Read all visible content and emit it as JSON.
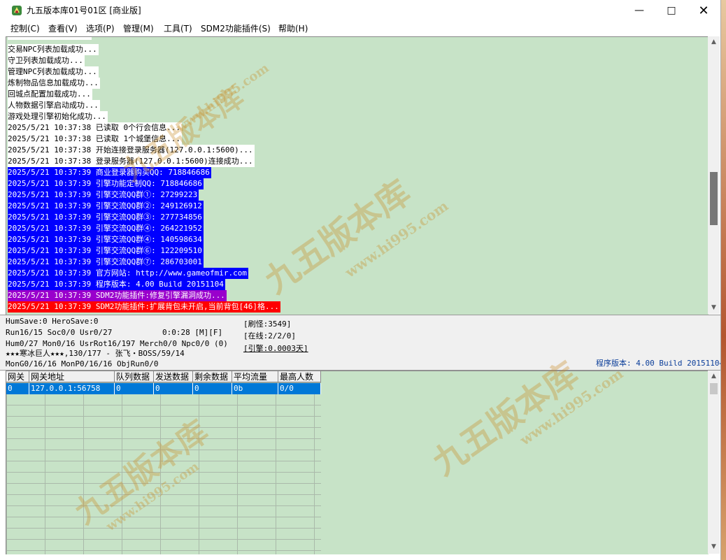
{
  "window": {
    "title": "九五版本库01号01区 [商业版]"
  },
  "menu": [
    "控制(C)",
    "查看(V)",
    "选项(P)",
    "管理(M)",
    "工具(T)",
    "SDM2功能插件(S)",
    "帮助(H)"
  ],
  "log": [
    {
      "text": "交易NPC列表加载成功...",
      "bg": "#ffffff",
      "fg": "#000000"
    },
    {
      "text": "守卫列表加载成功...",
      "bg": "#ffffff",
      "fg": "#000000"
    },
    {
      "text": "管理NPC列表加载成功...",
      "bg": "#ffffff",
      "fg": "#000000"
    },
    {
      "text": "炼制物品信息加载成功...",
      "bg": "#ffffff",
      "fg": "#000000"
    },
    {
      "text": "回城点配置加载成功...",
      "bg": "#ffffff",
      "fg": "#000000"
    },
    {
      "text": "人物数据引擎启动成功...",
      "bg": "#ffffff",
      "fg": "#000000"
    },
    {
      "text": "游戏处理引擎初始化成功...",
      "bg": "#ffffff",
      "fg": "#000000"
    },
    {
      "text": "2025/5/21 10:37:38 已读取 0个行会信息...",
      "bg": "#ffffff",
      "fg": "#000000"
    },
    {
      "text": "2025/5/21 10:37:38 已读取 1个城堡信息...",
      "bg": "#ffffff",
      "fg": "#000000"
    },
    {
      "text": "2025/5/21 10:37:38 开始连接登录服务器(127.0.0.1:5600)...",
      "bg": "#ffffff",
      "fg": "#000000"
    },
    {
      "text": "2025/5/21 10:37:38 登录服务器(127.0.0.1:5600)连接成功...",
      "bg": "#ffffff",
      "fg": "#000000"
    },
    {
      "text": "2025/5/21 10:37:39 商业登录器购买QQ: 718846686",
      "bg": "#0000ff",
      "fg": "#ffffff"
    },
    {
      "text": "2025/5/21 10:37:39 引擎功能定制QQ: 718846686",
      "bg": "#0000ff",
      "fg": "#ffffff"
    },
    {
      "text": "2025/5/21 10:37:39 引擎交流QQ群①: 27299223",
      "bg": "#0000ff",
      "fg": "#ffffff"
    },
    {
      "text": "2025/5/21 10:37:39 引擎交流QQ群②: 249126912",
      "bg": "#0000ff",
      "fg": "#ffffff"
    },
    {
      "text": "2025/5/21 10:37:39 引擎交流QQ群③: 277734856",
      "bg": "#0000ff",
      "fg": "#ffffff"
    },
    {
      "text": "2025/5/21 10:37:39 引擎交流QQ群④: 264221952",
      "bg": "#0000ff",
      "fg": "#ffffff"
    },
    {
      "text": "2025/5/21 10:37:39 引擎交流QQ群④: 140598634",
      "bg": "#0000ff",
      "fg": "#ffffff"
    },
    {
      "text": "2025/5/21 10:37:39 引擎交流QQ群⑥: 122209510",
      "bg": "#0000ff",
      "fg": "#ffffff"
    },
    {
      "text": "2025/5/21 10:37:39 引擎交流QQ群⑦: 286703001",
      "bg": "#0000ff",
      "fg": "#ffffff"
    },
    {
      "text": "2025/5/21 10:37:39 官方网站: http://www.gameofmir.com",
      "bg": "#0000ff",
      "fg": "#ffffff"
    },
    {
      "text": "2025/5/21 10:37:39 程序版本: 4.00 Build 20151104",
      "bg": "#0000ff",
      "fg": "#ffffff"
    },
    {
      "text": "2025/5/21 10:37:39 SDM2功能插件:修复引擎漏洞成功...",
      "bg": "#9900cc",
      "fg": "#ffffff"
    },
    {
      "text": "2025/5/21 10:37:39 SDM2功能插件:扩展背包未开启,当前背包[46]格...",
      "bg": "#ff0000",
      "fg": "#ffffff"
    }
  ],
  "status": {
    "line1": "HumSave:0 HeroSave:0",
    "line2": "Run16/15 Soc0/0 Usr0/27",
    "time": "0:0:28 [M][F]",
    "line3": "Hum0/27 Mon0/16 UsrRot16/197 Merch0/0 Npc0/0 (0)",
    "line4": "★★★寒冰巨人★★★,130/177 - 张飞・BOSS/59/14",
    "line5": "MonG0/16/16 MonP0/16/16 ObjRun0/0",
    "refresh": "[刷怪:3549]",
    "online": "[在线:2/2/0]",
    "engine": "[引擎:0.0003天]",
    "version": "程序版本: 4.00 Build 20151104"
  },
  "table": {
    "headers": [
      "网关",
      "网关地址",
      "队列数据",
      "发送数据",
      "剩余数据",
      "平均流量",
      "最高人数"
    ],
    "rows": [
      [
        "0",
        "127.0.0.1:56758",
        "0",
        "0",
        "0",
        "0b",
        "0/0"
      ]
    ]
  },
  "watermark": {
    "cn": "九五版本库",
    "url": "www.hi995.com"
  }
}
